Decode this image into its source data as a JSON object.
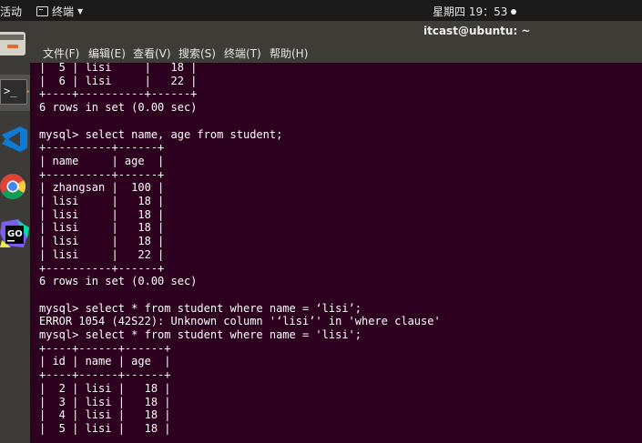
{
  "top_bar": {
    "activities": "活动",
    "app_menu": "终端",
    "clock": "星期四 19：53"
  },
  "dock": {
    "vscode_color": "#0e7ad1",
    "goland_label": "GO"
  },
  "window": {
    "title": "itcast@ubuntu: ~"
  },
  "menu": {
    "file": "文件(F)",
    "edit": "编辑(E)",
    "view": "查看(V)",
    "search": "搜索(S)",
    "terminal": "终端(T)",
    "help": "帮助(H)"
  },
  "terminal": {
    "lines": [
      "|  5 | lisi     |   18 |",
      "|  6 | lisi     |   22 |",
      "+----+----------+------+",
      "6 rows in set (0.00 sec)",
      "",
      "mysql> select name, age from student;",
      "+----------+------+",
      "| name     | age  |",
      "+----------+------+",
      "| zhangsan |  100 |",
      "| lisi     |   18 |",
      "| lisi     |   18 |",
      "| lisi     |   18 |",
      "| lisi     |   18 |",
      "| lisi     |   22 |",
      "+----------+------+",
      "6 rows in set (0.00 sec)",
      "",
      "mysql> select * from student where name = ‘lisi’;",
      "ERROR 1054 (42S22): Unknown column '‘lisi’' in 'where clause'",
      "mysql> select * from student where name = 'lisi';",
      "+----+------+------+",
      "| id | name | age  |",
      "+----+------+------+",
      "|  2 | lisi |   18 |",
      "|  3 | lisi |   18 |",
      "|  4 | lisi |   18 |",
      "|  5 | lisi |   18 |"
    ]
  }
}
